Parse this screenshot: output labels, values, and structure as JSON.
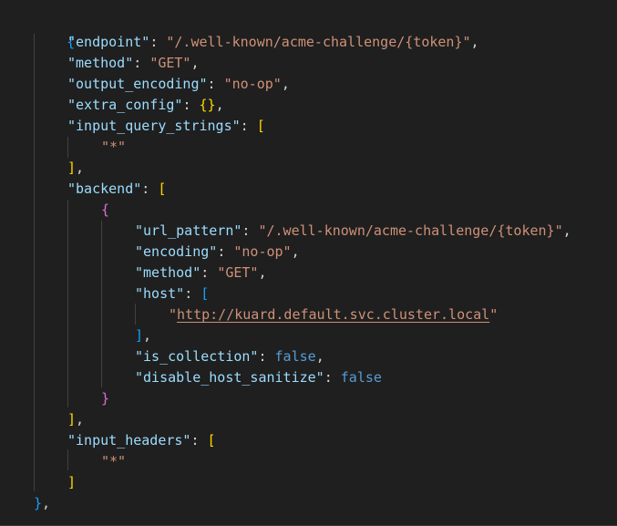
{
  "colors": {
    "background": "#1f1f1f",
    "key": "#9cdcfe",
    "string": "#ce9178",
    "keyword": "#569cd6",
    "bracket_level_1": "#179fff",
    "bracket_level_2": "#ffd700",
    "bracket_level_3": "#da70d6",
    "punctuation": "#d4d4d4"
  },
  "code": {
    "open_brace": "{",
    "endpoint": {
      "key": "\"endpoint\"",
      "value": "\"/.well-known/acme-challenge/{token}\""
    },
    "method": {
      "key": "\"method\"",
      "value": "\"GET\""
    },
    "output_encoding": {
      "key": "\"output_encoding\"",
      "value": "\"no-op\""
    },
    "extra_config": {
      "key": "\"extra_config\"",
      "value": "{}"
    },
    "input_query_strings": {
      "key": "\"input_query_strings\"",
      "open": "[",
      "item": "\"*\"",
      "close": "]"
    },
    "backend": {
      "key": "\"backend\"",
      "open": "[",
      "obj_open": "{",
      "url_pattern": {
        "key": "\"url_pattern\"",
        "value": "\"/.well-known/acme-challenge/{token}\""
      },
      "encoding": {
        "key": "\"encoding\"",
        "value": "\"no-op\""
      },
      "method": {
        "key": "\"method\"",
        "value": "\"GET\""
      },
      "host": {
        "key": "\"host\"",
        "open": "[",
        "quote": "\"",
        "url": "http://kuard.default.svc.cluster.local",
        "close": "]"
      },
      "is_collection": {
        "key": "\"is_collection\"",
        "value": "false"
      },
      "disable_host_sanitize": {
        "key": "\"disable_host_sanitize\"",
        "value": "false"
      },
      "obj_close": "}",
      "close": "]"
    },
    "input_headers": {
      "key": "\"input_headers\"",
      "open": "[",
      "item": "\"*\"",
      "close": "]"
    },
    "close_brace": "}"
  }
}
